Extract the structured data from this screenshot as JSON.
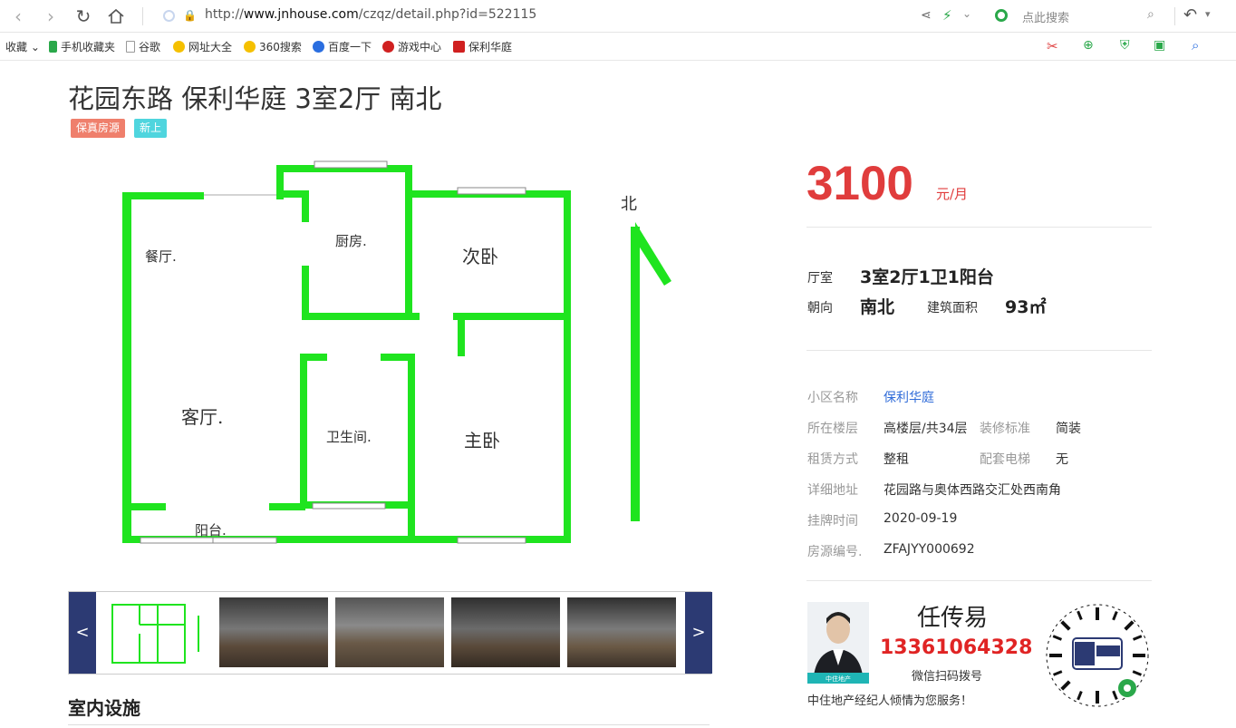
{
  "browser": {
    "url_prefix": "http://",
    "url_domain": "www.jnhouse.com",
    "url_path": "/czqz/detail.php?id=522115",
    "search_placeholder": "点此搜索"
  },
  "bookmarks": [
    {
      "label": "收藏",
      "icon": "star-icon",
      "color": "#f0a020"
    },
    {
      "label": "手机收藏夹",
      "icon": "phone-icon",
      "color": "#2aa84a"
    },
    {
      "label": "谷歌",
      "icon": "page-icon",
      "color": "#999999"
    },
    {
      "label": "网址大全",
      "icon": "360-icon",
      "color": "#f5c000"
    },
    {
      "label": "360搜索",
      "icon": "360-icon",
      "color": "#f5c000"
    },
    {
      "label": "百度一下",
      "icon": "baidu-paw-icon",
      "color": "#2a6ee0"
    },
    {
      "label": "游戏中心",
      "icon": "game-icon",
      "color": "#d02020"
    },
    {
      "label": "保利华庭",
      "icon": "house-icon",
      "color": "#d02020"
    }
  ],
  "listing": {
    "title": "花园东路 保利华庭 3室2厅 南北",
    "tags": [
      {
        "label": "保真房源",
        "color": "#ef7f6c"
      },
      {
        "label": "新上",
        "color": "#4fd5de"
      }
    ],
    "price": "3100",
    "price_unit": "元/月"
  },
  "floorplan": {
    "rooms": [
      "餐厅.",
      "厨房.",
      "次卧",
      "客厅.",
      "卫生间.",
      "主卧",
      "阳台."
    ],
    "north": "北"
  },
  "gallery": {
    "prev": "<",
    "next": ">"
  },
  "summary": {
    "layout_label": "厅室",
    "layout_value": "3室2厅1卫1阳台",
    "orientation_label": "朝向",
    "orientation_value": "南北",
    "area_label": "建筑面积",
    "area_value": "93㎡"
  },
  "details": [
    {
      "label": "小区名称",
      "value": "保利华庭",
      "link": true
    },
    {
      "label": "所在楼层",
      "value": "高楼层/共34层"
    },
    {
      "label": "租赁方式",
      "value": "整租"
    },
    {
      "label": "详细地址",
      "value": "花园路与奥体西路交汇处西南角"
    },
    {
      "label": "挂牌时间",
      "value": "2020-09-19"
    },
    {
      "label": "房源编号.",
      "value": "ZFAJYY000692"
    }
  ],
  "details_right": [
    {
      "label": "装修标准",
      "value": "简装"
    },
    {
      "label": "配套电梯",
      "value": "无"
    }
  ],
  "agent": {
    "name": "任传易",
    "phone": "13361064328",
    "wechat_hint": "微信扫码拨号",
    "slogan": "中住地产经纪人倾情为您服务！",
    "photo_badge": "中住地产"
  },
  "facilities_title": "室内设施"
}
